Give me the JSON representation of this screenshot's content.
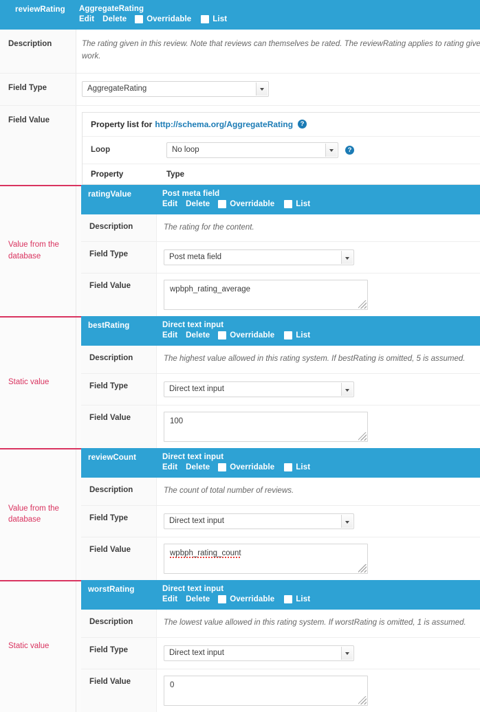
{
  "colors": {
    "header_blue": "#2ea2d4",
    "link_blue": "#1b7bb5",
    "annotation_red": "#d9335f"
  },
  "top_property": {
    "name": "reviewRating",
    "type": "AggregateRating",
    "actions": {
      "edit": "Edit",
      "delete": "Delete"
    },
    "checkboxes": {
      "overridable": "Overridable",
      "list": "List"
    },
    "rows": {
      "description_label": "Description",
      "description_text": "The rating given in this review. Note that reviews can themselves be rated. The reviewRating applies to rating given itself, as a creative work.",
      "field_type_label": "Field Type",
      "field_type_value": "AggregateRating",
      "field_value_label": "Field Value"
    }
  },
  "panel": {
    "heading_prefix": "Property list for",
    "heading_link": "http://schema.org/AggregateRating",
    "help_icon": "help-icon",
    "loop_label": "Loop",
    "loop_value": "No loop",
    "column_headers": {
      "property": "Property",
      "type": "Type"
    }
  },
  "labels": {
    "description": "Description",
    "field_type": "Field Type",
    "field_value": "Field Value",
    "edit": "Edit",
    "delete": "Delete",
    "overridable": "Overridable",
    "list": "List"
  },
  "properties": [
    {
      "name": "ratingValue",
      "type": "Post meta field",
      "annotation": "Value from the database",
      "description": "The rating for the content.",
      "field_type": "Post meta field",
      "field_value": "wpbph_rating_average",
      "misspelled": false
    },
    {
      "name": "bestRating",
      "type": "Direct text input",
      "annotation": "Static value",
      "description": "The highest value allowed in this rating system. If bestRating is omitted, 5 is assumed.",
      "field_type": "Direct text input",
      "field_value": "100",
      "misspelled": false
    },
    {
      "name": "reviewCount",
      "type": "Direct text input",
      "annotation": "Value from the database",
      "description": "The count of total number of reviews.",
      "field_type": "Direct text input",
      "field_value": "wpbph_rating_count",
      "misspelled": true
    },
    {
      "name": "worstRating",
      "type": "Direct text input",
      "annotation": "Static value",
      "description": "The lowest value allowed in this rating system. If worstRating is omitted, 1 is assumed.",
      "field_type": "Direct text input",
      "field_value": "0",
      "misspelled": false
    }
  ]
}
